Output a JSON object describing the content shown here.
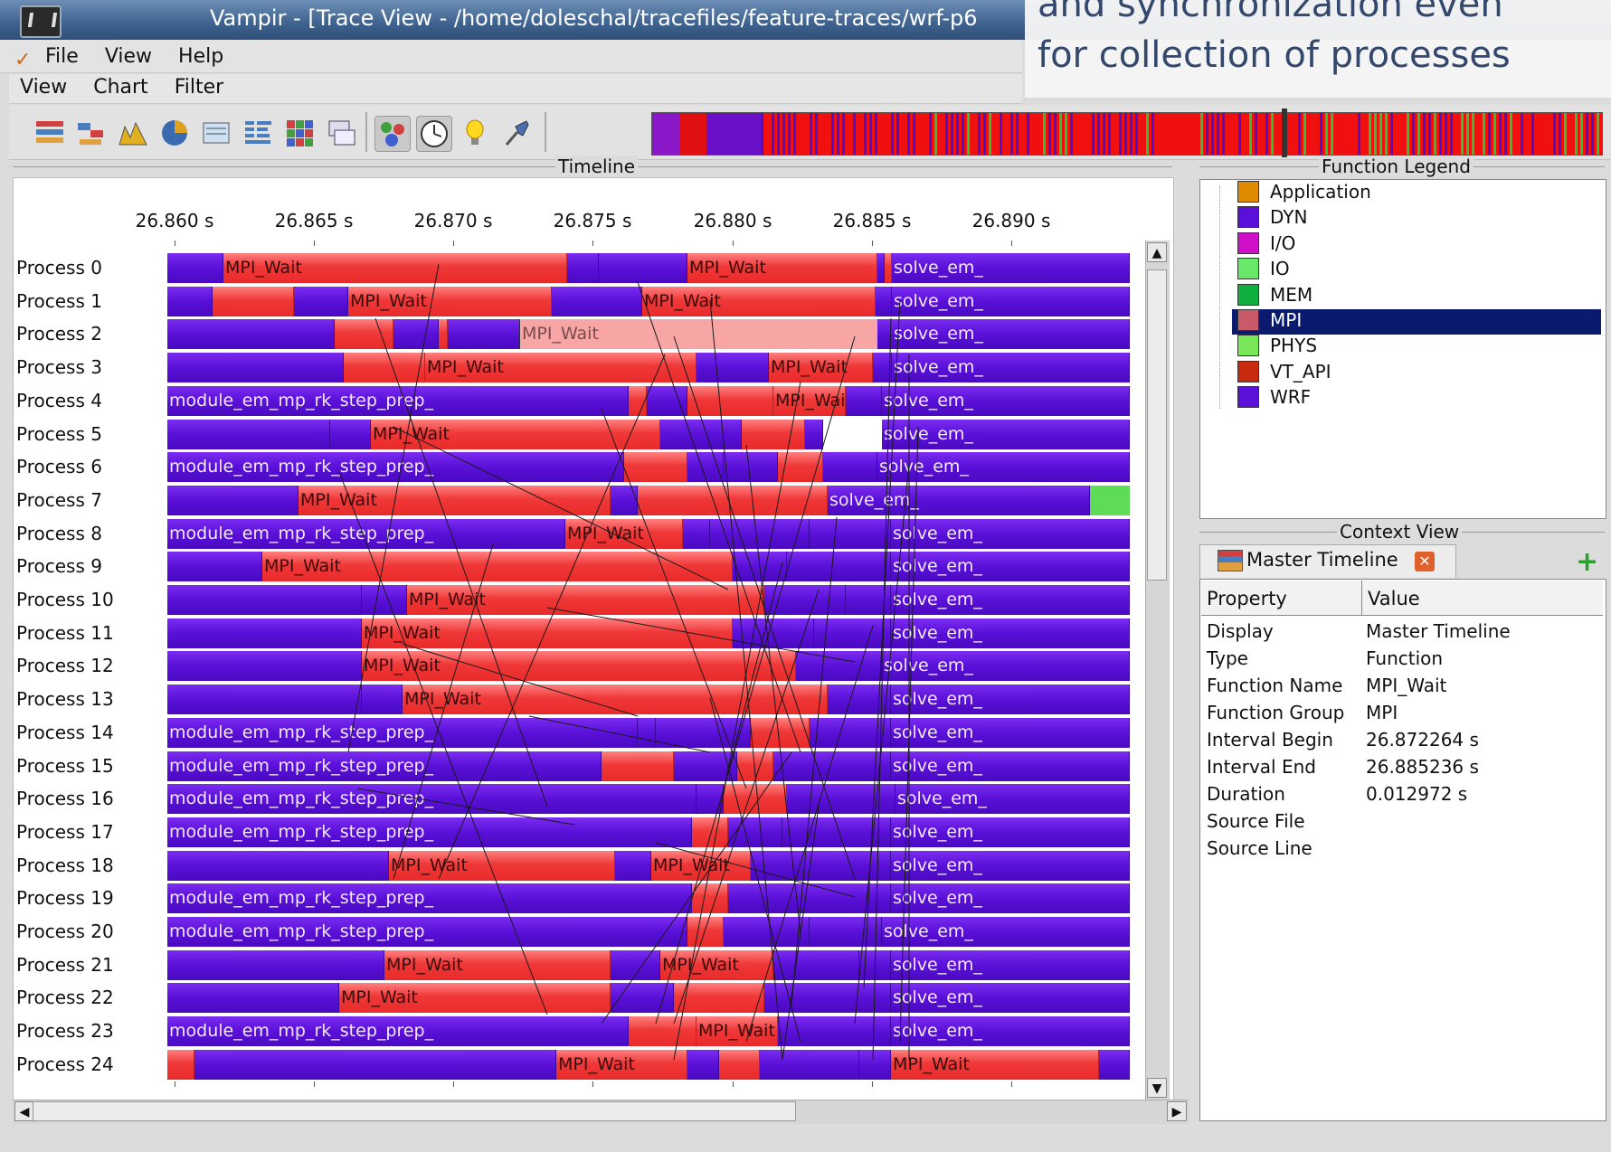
{
  "window": {
    "title": "Vampir - [Trace View - /home/doleschal/tracefiles/feature-traces/wrf-p6"
  },
  "overlay_caption": {
    "line1": "and synchronization even",
    "line2": "for collection of processes"
  },
  "menubar_main": [
    "File",
    "View",
    "Help"
  ],
  "menubar_trace": [
    "View",
    "Chart",
    "Filter"
  ],
  "toolbar": {
    "icons": [
      "master-timeline-icon",
      "process-timeline-icon",
      "counter-timeline-icon",
      "function-summary-icon",
      "message-summary-icon",
      "process-summary-icon",
      "communication-matrix-icon",
      "io-events-icon",
      "call-tree-icon",
      "clock-icon",
      "info-icon",
      "pin-icon"
    ]
  },
  "timeline": {
    "title": "Timeline",
    "ticks": [
      "26.860 s",
      "26.865 s",
      "26.870 s",
      "26.875 s",
      "26.880 s",
      "26.885 s",
      "26.890 s"
    ],
    "processes": [
      "Process 0",
      "Process 1",
      "Process 2",
      "Process 3",
      "Process 4",
      "Process 5",
      "Process 6",
      "Process 7",
      "Process 8",
      "Process 9",
      "Process 10",
      "Process 11",
      "Process 12",
      "Process 13",
      "Process 14",
      "Process 15",
      "Process 16",
      "Process 17",
      "Process 18",
      "Process 19",
      "Process 20",
      "Process 21",
      "Process 22",
      "Process 23",
      "Process 24"
    ],
    "func_labels": {
      "mpi_wait": "MPI_Wait",
      "solve_em": "solve_em_",
      "module_prep": "module_em_mp_rk_step_prep_"
    }
  },
  "legend": {
    "title": "Function Legend",
    "items": [
      {
        "label": "Application",
        "color": "#e08a00"
      },
      {
        "label": "DYN",
        "color": "#5a10d8"
      },
      {
        "label": "I/O",
        "color": "#d010c8"
      },
      {
        "label": "IO",
        "color": "#6ae86a"
      },
      {
        "label": "MEM",
        "color": "#10b040"
      },
      {
        "label": "MPI",
        "color": "#c85a6a"
      },
      {
        "label": "PHYS",
        "color": "#78e858"
      },
      {
        "label": "VT_API",
        "color": "#c82a10"
      },
      {
        "label": "WRF",
        "color": "#5a10d8"
      }
    ],
    "selected": "MPI"
  },
  "context_view": {
    "title": "Context View",
    "tab_label": "Master Timeline",
    "columns": [
      "Property",
      "Value"
    ],
    "rows": [
      {
        "property": "Display",
        "value": "Master Timeline"
      },
      {
        "property": "Type",
        "value": "Function"
      },
      {
        "property": "Function Name",
        "value": "MPI_Wait"
      },
      {
        "property": "Function Group",
        "value": "MPI"
      },
      {
        "property": "Interval Begin",
        "value": "26.872264 s"
      },
      {
        "property": "Interval End",
        "value": "26.885236 s"
      },
      {
        "property": "Duration",
        "value": "0.012972 s"
      },
      {
        "property": "Source File",
        "value": ""
      },
      {
        "property": "Source Line",
        "value": ""
      }
    ]
  },
  "colors": {
    "mpi": "#f03838",
    "wrf": "#5a10d8",
    "io": "#5edc58",
    "selection": "#0a1a6c"
  }
}
